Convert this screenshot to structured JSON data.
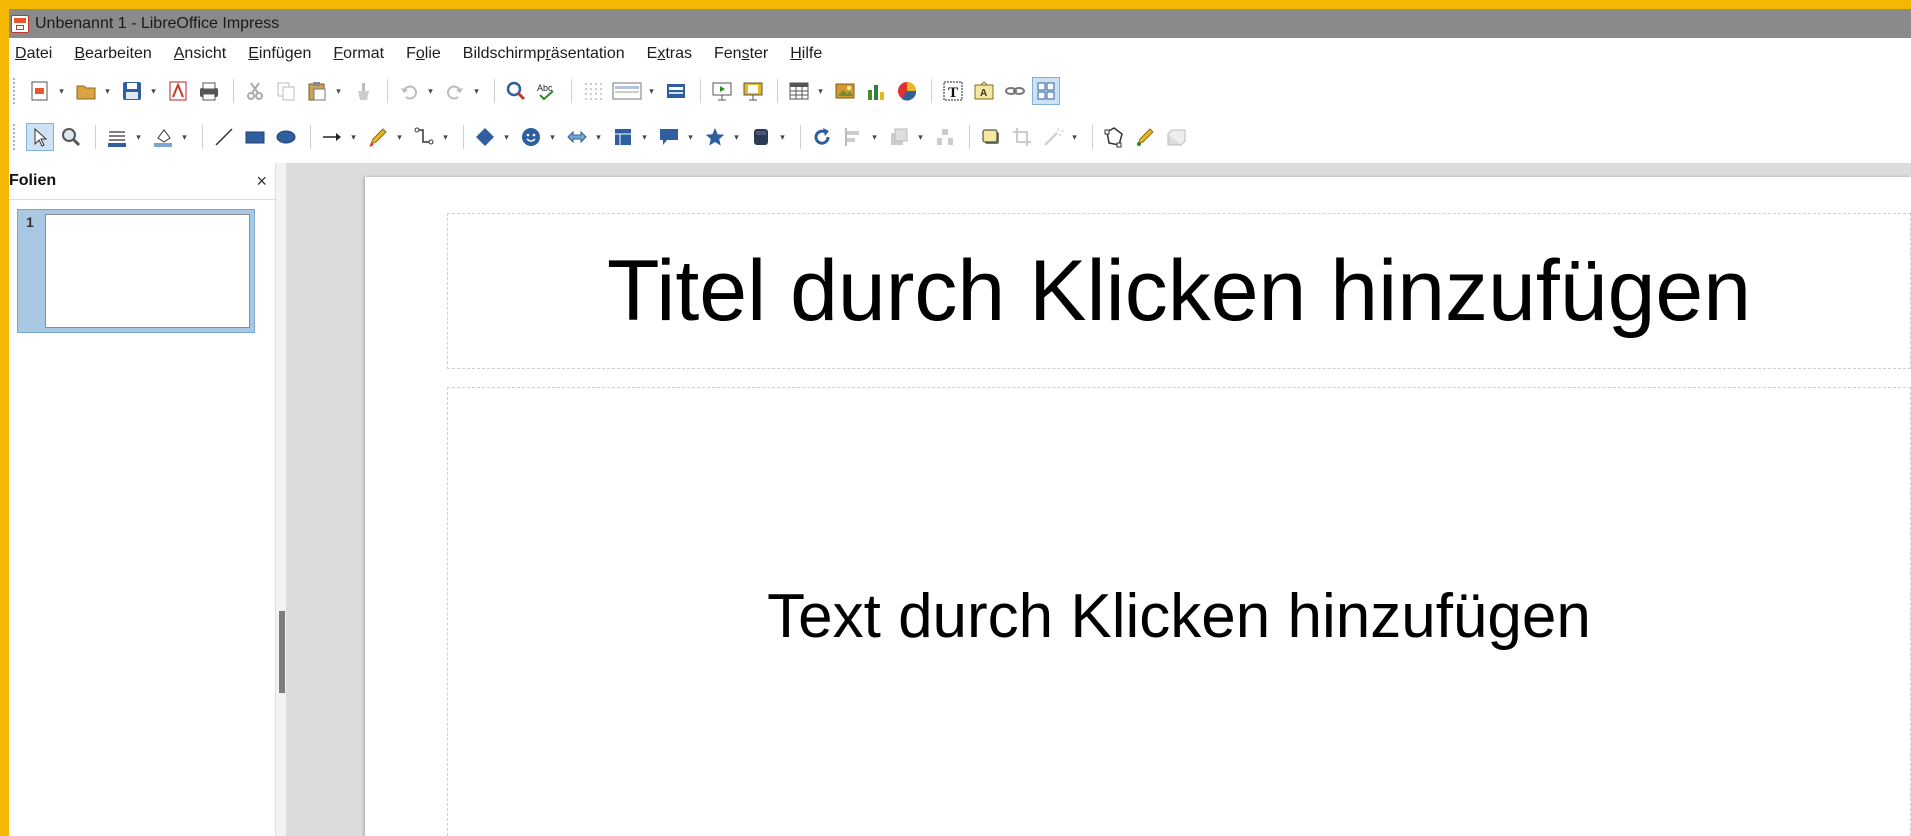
{
  "window": {
    "title": "Unbenannt 1 - LibreOffice Impress"
  },
  "menu": [
    {
      "label": "Datei"
    },
    {
      "label": "Bearbeiten"
    },
    {
      "label": "Ansicht"
    },
    {
      "label": "Einfügen"
    },
    {
      "label": "Format"
    },
    {
      "label": "Folie"
    },
    {
      "label": "Bildschirmpräsentation"
    },
    {
      "label": "Extras"
    },
    {
      "label": "Fenster"
    },
    {
      "label": "Hilfe"
    }
  ],
  "toolbar_icons": {
    "standard": [
      "new",
      "open",
      "save",
      "export-pdf",
      "print",
      "cut",
      "copy",
      "paste",
      "clone-formatting",
      "undo",
      "redo",
      "spelling-find",
      "spellcheck",
      "grid",
      "display-views",
      "master-slide",
      "start-presentation",
      "start-from-current",
      "table",
      "image",
      "chart",
      "color-circle",
      "text-box",
      "fontwork",
      "hyperlink",
      "display-grid"
    ],
    "drawing": [
      "select",
      "zoom",
      "line-color",
      "fill-color",
      "line",
      "rectangle",
      "ellipse",
      "arrow",
      "curve",
      "connector",
      "basic-shapes",
      "symbol-shapes",
      "block-arrows",
      "flowchart",
      "callouts",
      "stars",
      "3d-objects",
      "rotate",
      "align",
      "arrange",
      "distribute",
      "shadow",
      "crop",
      "filter",
      "points",
      "glue-points",
      "toggle-extrusion"
    ]
  },
  "colors": {
    "accent_border": "#f5b800",
    "title_bar": "#8a8a8a"
  },
  "slides_panel": {
    "title": "Folien",
    "close": "×",
    "slides": [
      {
        "number": "1"
      }
    ]
  },
  "slide": {
    "title_placeholder": "Titel durch Klicken hinzufügen",
    "text_placeholder": "Text durch Klicken hinzufügen"
  }
}
